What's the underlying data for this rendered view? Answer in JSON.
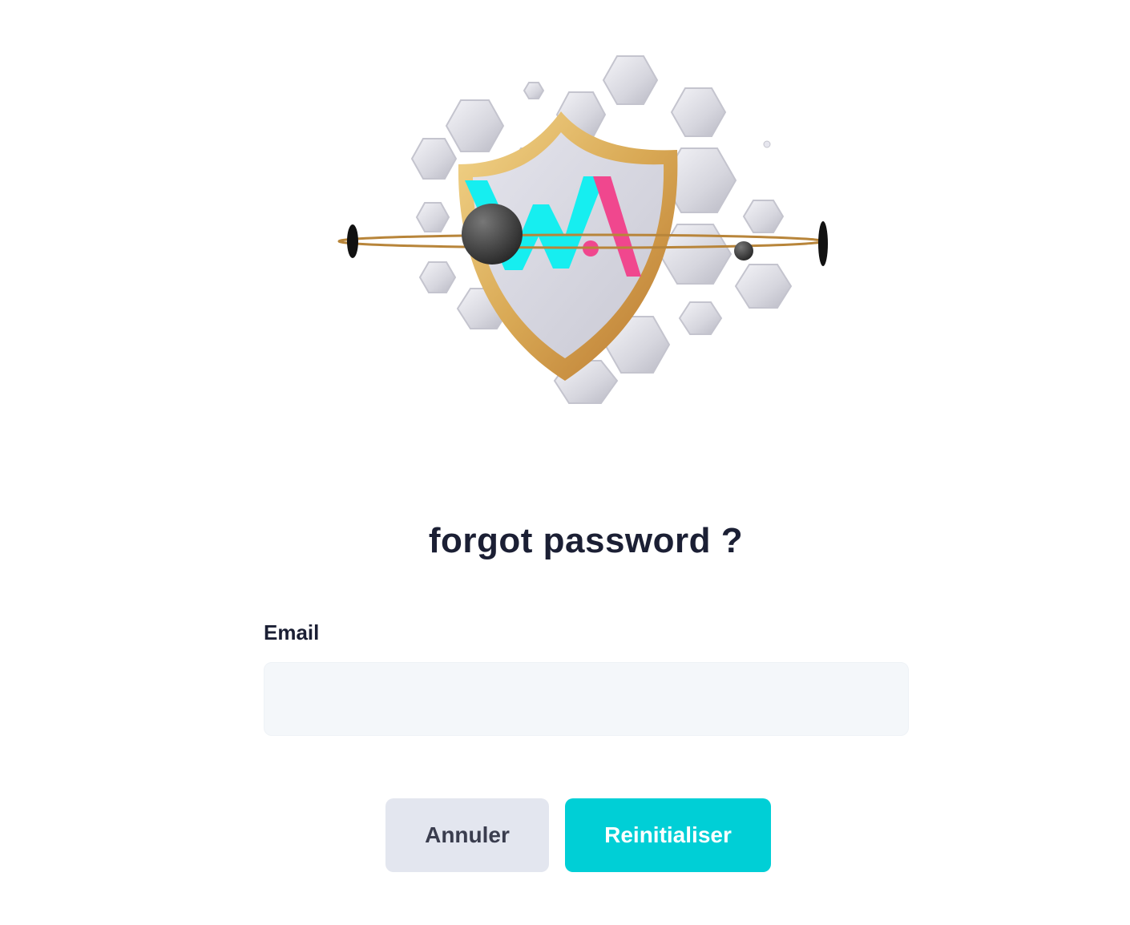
{
  "header": {
    "title": "forgot password ?"
  },
  "form": {
    "email_label": "Email",
    "email_value": "",
    "email_placeholder": ""
  },
  "actions": {
    "cancel_label": "Annuler",
    "submit_label": "Reinitialiser"
  },
  "illustration": {
    "icon": "shield-logo-icon",
    "colors": {
      "cyan": "#16eef0",
      "pink": "#f0478e",
      "gold": "#d4a24a"
    }
  },
  "colors": {
    "primary": "#00cfd6",
    "secondary": "#e3e6ef",
    "text": "#1b1f34",
    "input_bg": "#f4f7fa"
  }
}
